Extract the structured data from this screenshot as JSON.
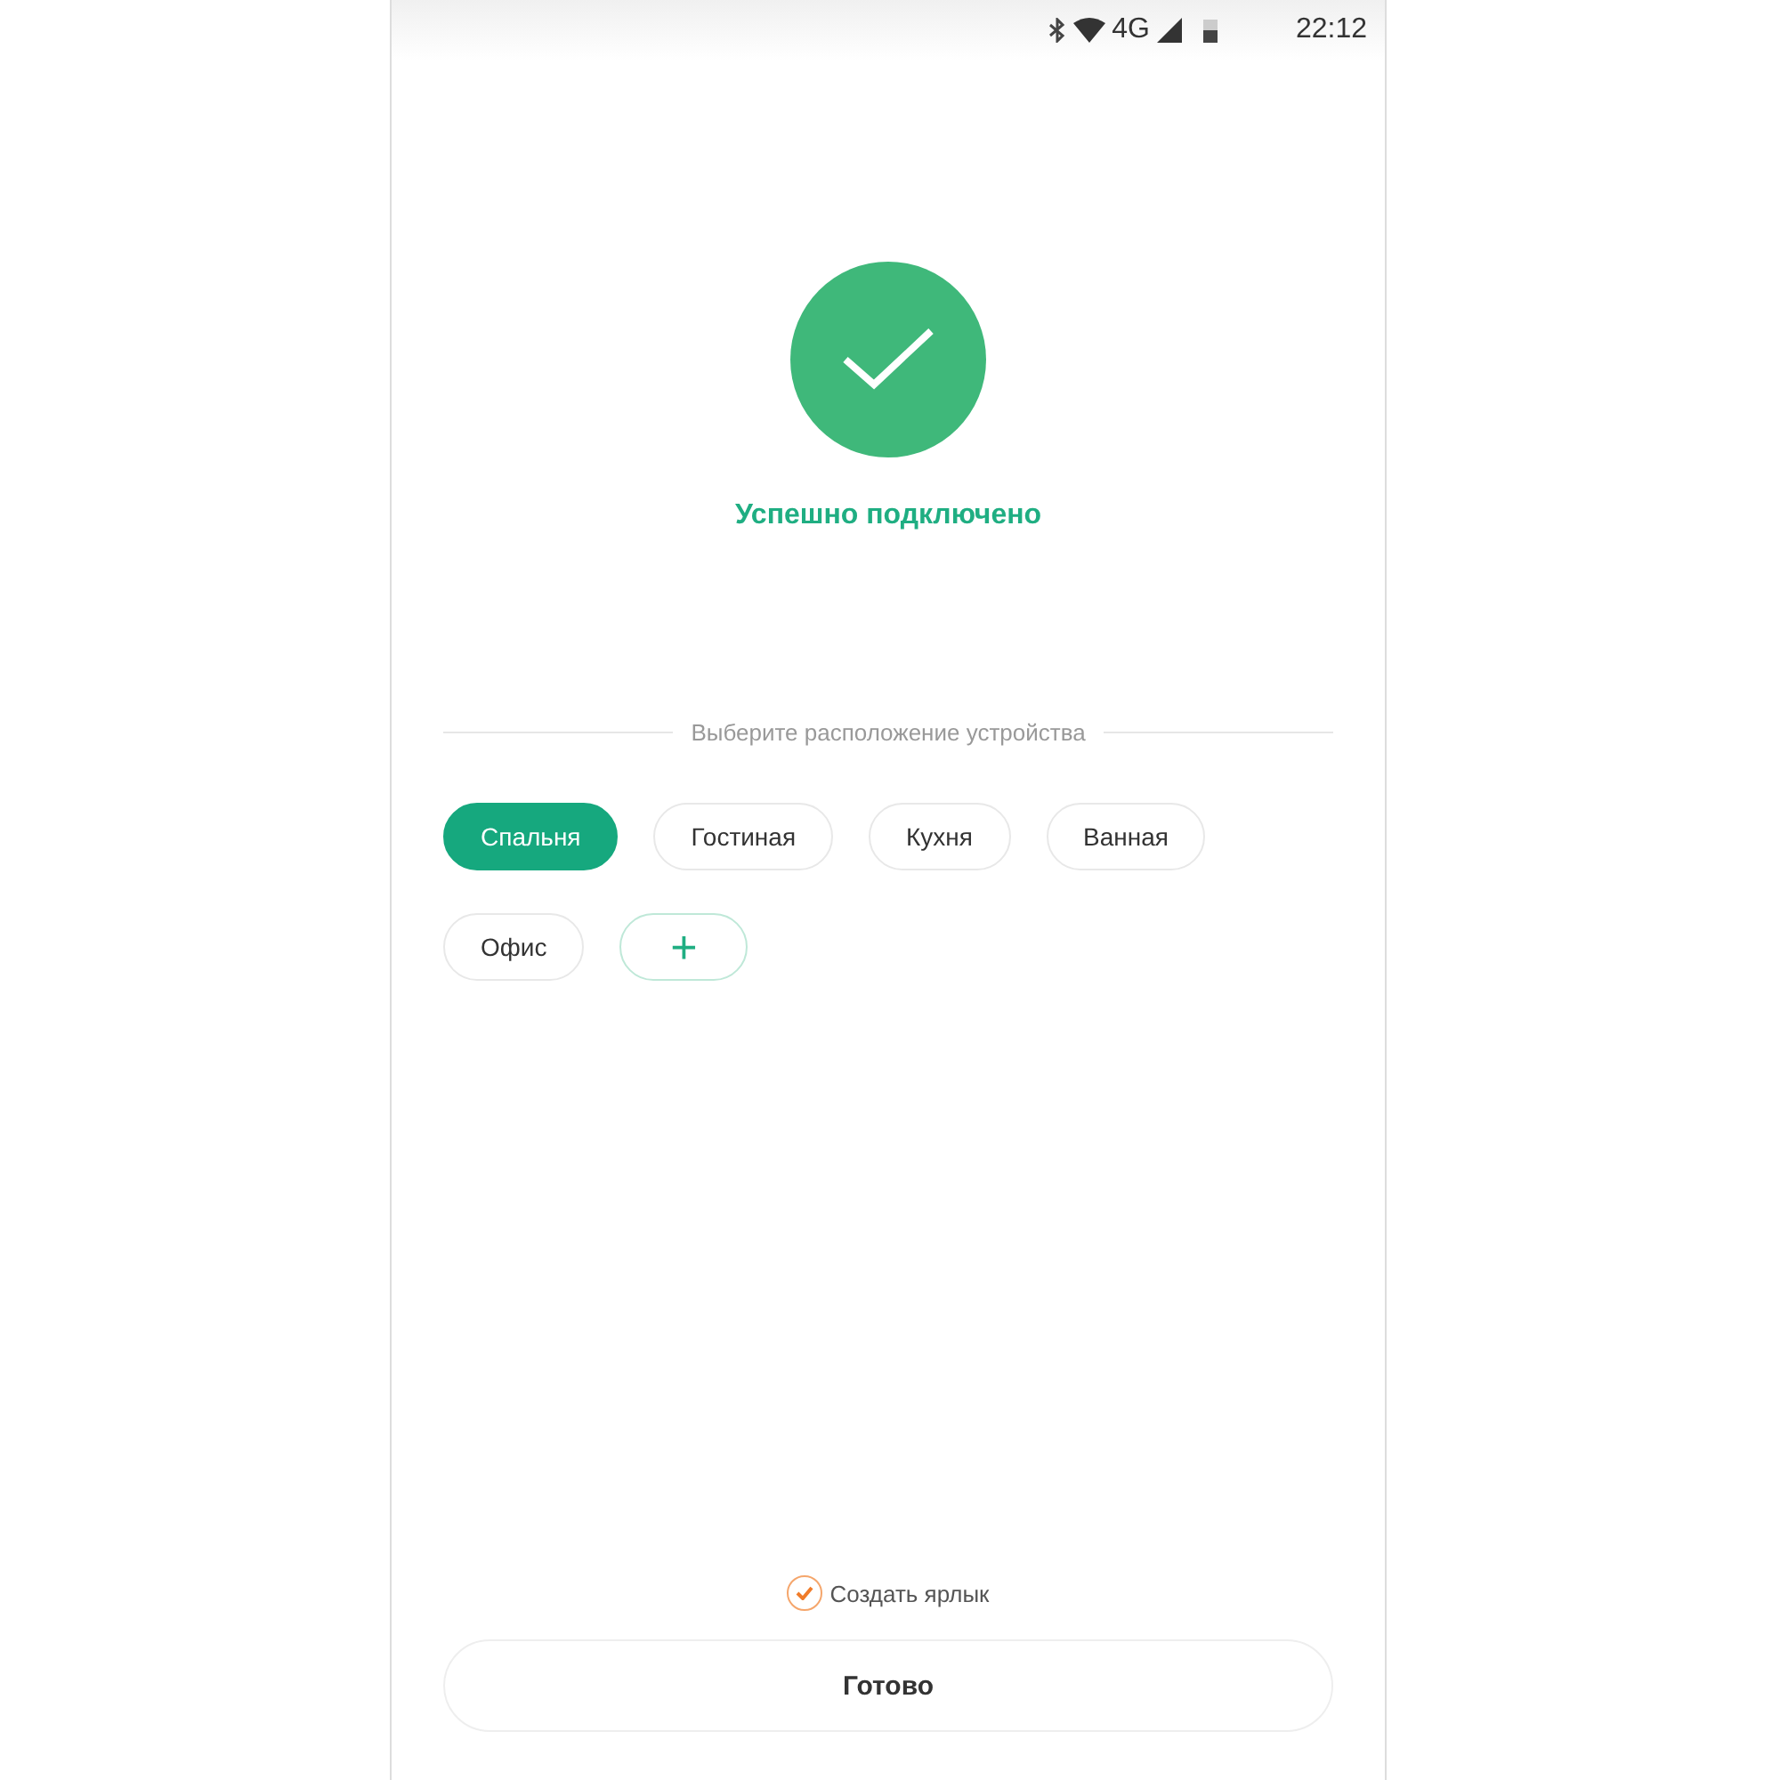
{
  "status_bar": {
    "network": "4G",
    "time": "22:12"
  },
  "title": "Успешно подключено",
  "location": {
    "heading": "Выберите расположение устройства",
    "rooms": [
      {
        "label": "Спальня",
        "selected": true
      },
      {
        "label": "Гостиная",
        "selected": false
      },
      {
        "label": "Кухня",
        "selected": false
      },
      {
        "label": "Ванная",
        "selected": false
      },
      {
        "label": "Офис",
        "selected": false
      }
    ],
    "add_button": "+"
  },
  "shortcut": {
    "label": "Создать ярлык",
    "checked": true
  },
  "done_button": "Готово"
}
